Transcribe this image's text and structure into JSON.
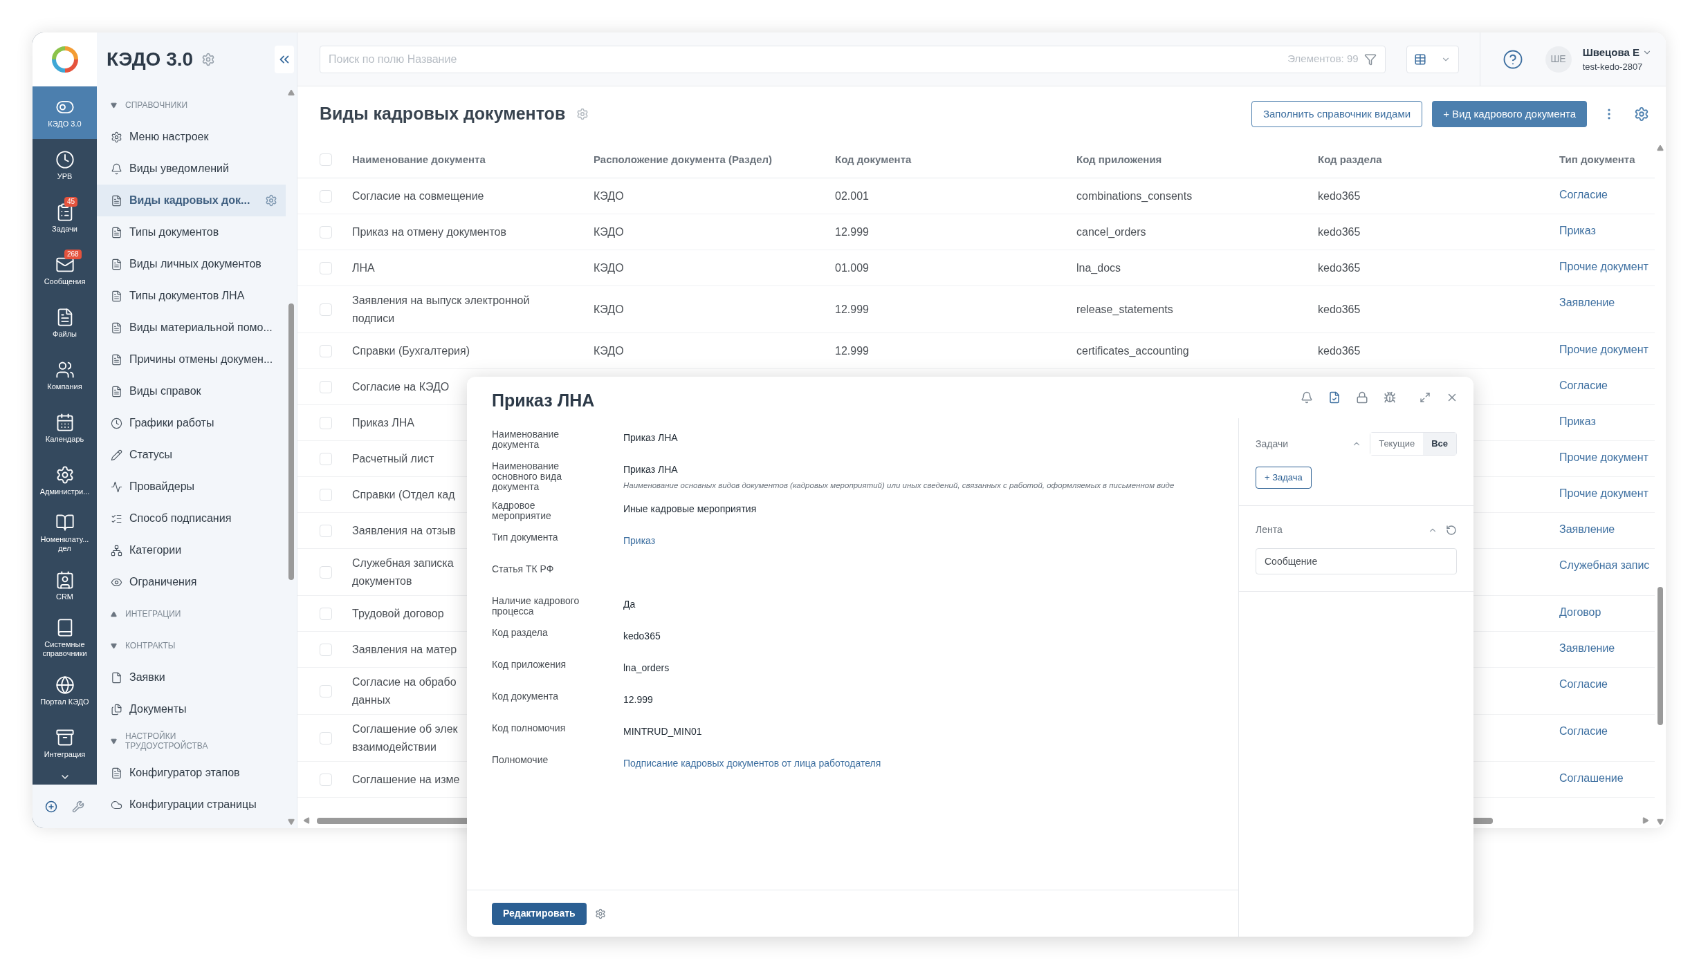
{
  "rail": {
    "items": [
      {
        "label": "КЭДО 3.0",
        "selected": true
      },
      {
        "label": "УРВ",
        "selected": false
      },
      {
        "label": "Задачи",
        "selected": false,
        "badge": "45"
      },
      {
        "label": "Сообщения",
        "selected": false,
        "badge": "268"
      },
      {
        "label": "Файлы",
        "selected": false
      },
      {
        "label": "Компания",
        "selected": false
      },
      {
        "label": "Календарь",
        "selected": false
      },
      {
        "label": "Администри...",
        "selected": false
      },
      {
        "label": "Номенклату... дел",
        "selected": false
      },
      {
        "label": "CRM",
        "selected": false
      },
      {
        "label": "Системные справочники",
        "selected": false
      },
      {
        "label": "Портал КЭДО",
        "selected": false
      },
      {
        "label": "Интеграция",
        "selected": false
      }
    ]
  },
  "nav": {
    "title": "КЭДО 3.0",
    "sections": [
      {
        "title": "СПРАВОЧНИКИ",
        "expanded": true,
        "items": [
          {
            "label": "Меню настроек",
            "selected": false
          },
          {
            "label": "Виды уведомлений",
            "selected": false
          },
          {
            "label": "Виды кадровых док...",
            "selected": true
          },
          {
            "label": "Типы документов",
            "selected": false
          },
          {
            "label": "Виды личных документов",
            "selected": false
          },
          {
            "label": "Типы документов ЛНА",
            "selected": false
          },
          {
            "label": "Виды материальной помо...",
            "selected": false
          },
          {
            "label": "Причины отмены докумен...",
            "selected": false
          },
          {
            "label": "Виды справок",
            "selected": false
          },
          {
            "label": "Графики работы",
            "selected": false
          },
          {
            "label": "Статусы",
            "selected": false
          },
          {
            "label": "Провайдеры",
            "selected": false
          },
          {
            "label": "Способ подписания",
            "selected": false
          },
          {
            "label": "Категории",
            "selected": false
          },
          {
            "label": "Ограничения",
            "selected": false
          }
        ]
      },
      {
        "title": "ИНТЕГРАЦИИ",
        "expanded": false
      },
      {
        "title": "КОНТРАКТЫ",
        "expanded": true,
        "items": [
          {
            "label": "Заявки",
            "selected": false
          },
          {
            "label": "Документы",
            "selected": false
          }
        ]
      },
      {
        "title": "НАСТРОЙКИ ТРУДОУСТРОЙСТВА",
        "expanded": true,
        "items": [
          {
            "label": "Конфигуратор этапов",
            "selected": false
          },
          {
            "label": "Конфигурации страницы",
            "selected": false
          }
        ]
      }
    ]
  },
  "topbar": {
    "search": {
      "placeholder": "Поиск по полю Название"
    },
    "view_menu": {
      "open": false
    },
    "count": "Элементов: 99",
    "user": {
      "initials": "ШЕ",
      "name": "Швецова Е",
      "login": "test-kedo-2807"
    }
  },
  "page": {
    "title": "Виды кадровых документов",
    "buttons": [
      {
        "label": "Заполнить справочник видами",
        "kind": "outline"
      },
      {
        "label": "+ Вид кадрового документа",
        "kind": "primary"
      }
    ]
  },
  "table": {
    "all_checked": false,
    "columns": [
      "Наименование документа",
      "Расположение документа (Раздел)",
      "Код документа",
      "Код приложения",
      "Код раздела",
      "Тип документа"
    ],
    "rows": [
      {
        "checked": false,
        "name": [
          "Согласие на совмещение"
        ],
        "location": "КЭДО",
        "doc_code": "02.001",
        "app_code": "combinations_consents",
        "section_code": "kedo365",
        "type": "Согласие"
      },
      {
        "checked": false,
        "name": [
          "Приказ на отмену документов"
        ],
        "location": "КЭДО",
        "doc_code": "12.999",
        "app_code": "cancel_orders",
        "section_code": "kedo365",
        "type": "Приказ"
      },
      {
        "checked": false,
        "name": [
          "ЛНА"
        ],
        "location": "КЭДО",
        "doc_code": "01.009",
        "app_code": "lna_docs",
        "section_code": "kedo365",
        "type": "Прочие документ"
      },
      {
        "checked": false,
        "name": [
          "Заявления на выпуск электронной",
          "подписи"
        ],
        "location": "КЭДО",
        "doc_code": "12.999",
        "app_code": "release_statements",
        "section_code": "kedo365",
        "type": "Заявление"
      },
      {
        "checked": false,
        "name": [
          "Справки (Бухгалтерия)"
        ],
        "location": "КЭДО",
        "doc_code": "12.999",
        "app_code": "certificates_accounting",
        "section_code": "kedo365",
        "type": "Прочие документ"
      },
      {
        "checked": false,
        "name": [
          "Согласие на КЭДО"
        ],
        "type": "Согласие"
      },
      {
        "checked": false,
        "name": [
          "Приказ ЛНА"
        ],
        "type": "Приказ"
      },
      {
        "checked": false,
        "name": [
          "Расчетный лист"
        ],
        "type": "Прочие документ"
      },
      {
        "checked": false,
        "name": [
          "Справки (Отдел кад"
        ],
        "type": "Прочие документ"
      },
      {
        "checked": false,
        "name": [
          "Заявления на отзыв"
        ],
        "type": "Заявление"
      },
      {
        "checked": false,
        "name": [
          "Служебная записка",
          "документов"
        ],
        "type": "Служебная запис"
      },
      {
        "checked": false,
        "name": [
          "Трудовой договор"
        ],
        "type": "Договор"
      },
      {
        "checked": false,
        "name": [
          "Заявления на матер"
        ],
        "type": "Заявление"
      },
      {
        "checked": false,
        "name": [
          "Согласие на обрабо",
          "данных"
        ],
        "type": "Согласие"
      },
      {
        "checked": false,
        "name": [
          "Соглашение об элек",
          "взаимодействии"
        ],
        "type": "Согласие"
      },
      {
        "checked": false,
        "name": [
          "Соглашение на изме"
        ],
        "type": "Соглашение"
      }
    ]
  },
  "modal": {
    "title": "Приказ ЛНА",
    "fields": [
      {
        "label": "Наименование документа",
        "value": "Приказ ЛНА",
        "kind": "text"
      },
      {
        "label": "Наименование основного вида документа",
        "value": "Приказ ЛНА",
        "kind": "text",
        "hint": "Наименование основных видов документов (кадровых мероприятий) или иных сведений, связанных с работой, оформляемых в письменном виде"
      },
      {
        "label": "Кадровое мероприятие",
        "value": "Иные кадровые мероприятия",
        "kind": "text"
      },
      {
        "label": "Тип документа",
        "value": "Приказ",
        "kind": "link"
      },
      {
        "label": "Статья ТК РФ",
        "kind": "empty"
      },
      {
        "label": "Наличие кадрового процесса",
        "value": "Да",
        "kind": "text"
      },
      {
        "label": "Код раздела",
        "value": "kedo365",
        "kind": "text"
      },
      {
        "label": "Код приложения",
        "value": "lna_orders",
        "kind": "text"
      },
      {
        "label": "Код документа",
        "value": "12.999",
        "kind": "text"
      },
      {
        "label": "Код полномочия",
        "value": "MINTRUD_MIN01",
        "kind": "text"
      },
      {
        "label": "Полномочие",
        "value": "Подписание кадровых документов от лица работодателя",
        "kind": "link"
      }
    ],
    "tasks": {
      "title": "Задачи",
      "expanded": true,
      "filters": [
        {
          "label": "Текущие",
          "selected": false
        },
        {
          "label": "Все",
          "selected": true
        }
      ],
      "add_button": "+ Задача"
    },
    "feed": {
      "title": "Лента",
      "expanded": true,
      "placeholder": "Сообщение"
    },
    "edit_button": "Редактировать"
  }
}
